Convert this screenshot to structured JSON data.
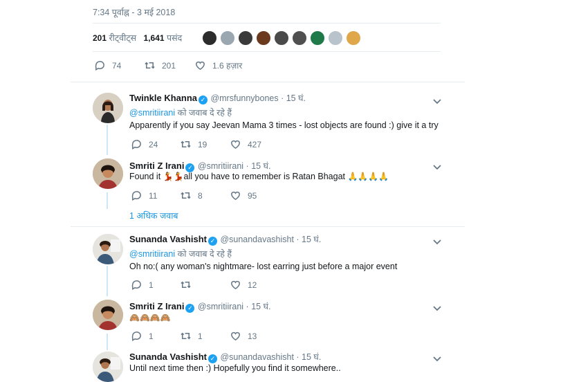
{
  "tweet": {
    "timestamp": "7:34 पूर्वाह्न - 3 मई 2018",
    "retweets_count": "201",
    "retweets_label": "रीट्वीट्स",
    "likes_count": "1,641",
    "likes_label": "पसंद",
    "actions": {
      "replies": "74",
      "retweets": "201",
      "likes": "1.6 हज़ार"
    }
  },
  "replies": [
    {
      "name": "Twinkle Khanna",
      "handle": "@mrsfunnybones · 15 घं.",
      "reply_to_handle": "@smritiirani",
      "reply_to_text": "को जवाब दे रहे हैं",
      "text": "Apparently if you say Jeevan Mama 3 times - lost objects are found :) give it a try",
      "counts": {
        "replies": "24",
        "retweets": "19",
        "likes": "427"
      }
    },
    {
      "name": "Smriti Z Irani",
      "handle": "@smritiirani · 15 घं.",
      "text_a": "Found it ",
      "emoji_a": "💃💃",
      "text_b": "all you have to remember is Ratan Bhagat ",
      "emoji_b": "🙏🙏🙏🙏",
      "counts": {
        "replies": "11",
        "retweets": "8",
        "likes": "95"
      }
    },
    {
      "more_replies": "1 अधिक जवाब"
    },
    {
      "name": "Sunanda Vashisht",
      "handle": "@sunandavashisht · 15 घं.",
      "reply_to_handle": "@smritiirani",
      "reply_to_text": "को जवाब दे रहे हैं",
      "text": "Oh no:( any woman's nightmare- lost earring just before a major event",
      "counts": {
        "replies": "1",
        "retweets": "",
        "likes": "12"
      }
    },
    {
      "name": "Smriti Z Irani",
      "handle": "@smritiirani · 15 घं.",
      "emoji": "🙈🙈🙈🙈",
      "counts": {
        "replies": "1",
        "retweets": "1",
        "likes": "13"
      }
    },
    {
      "name": "Sunanda Vashisht",
      "handle": "@sunandavashisht · 15 घं.",
      "text": "Until next time then :) Hopefully you find it somewhere.."
    }
  ],
  "colors": {
    "link": "#1b95e0",
    "muted": "#657786",
    "verified": "#1da1f2",
    "thread": "#cbe7f7"
  }
}
